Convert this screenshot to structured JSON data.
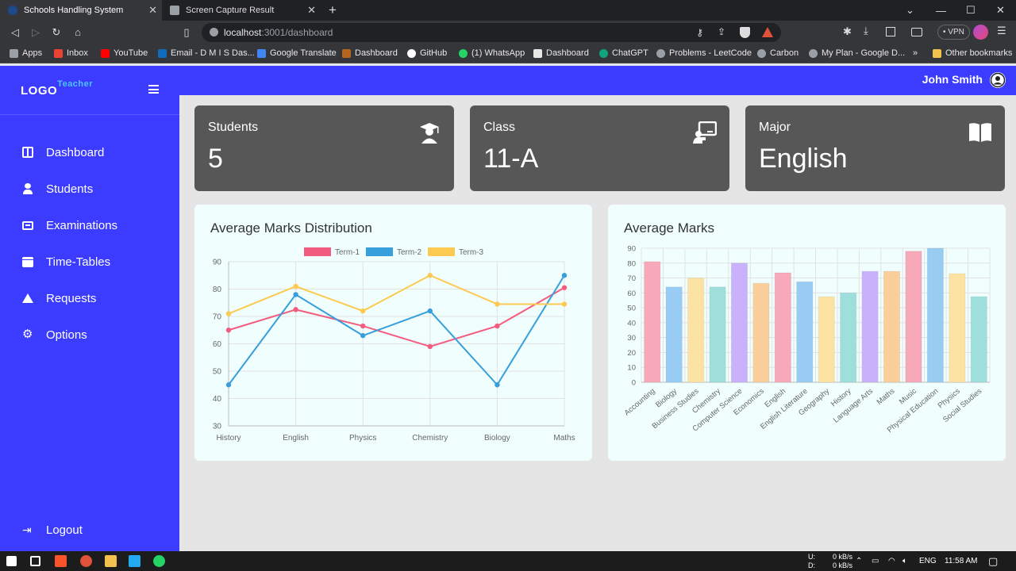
{
  "browser": {
    "tabs": [
      {
        "title": "Schools Handling System",
        "active": true
      },
      {
        "title": "Screen Capture Result",
        "active": false
      }
    ],
    "url_host": "localhost",
    "url_path": ":3001/dashboard",
    "vpn_label": "VPN",
    "bookmarks": [
      "Apps",
      "Inbox",
      "YouTube",
      "Email - D M I S Das...",
      "Google Translate",
      "Dashboard",
      "GitHub",
      "(1) WhatsApp",
      "Dashboard",
      "ChatGPT",
      "Problems - LeetCode",
      "Carbon",
      "My Plan - Google D...",
      "»",
      "Other bookmarks"
    ]
  },
  "sidebar": {
    "logo": "LOGO",
    "logo_sup": "Teacher",
    "items": [
      {
        "label": "Dashboard",
        "icon": "dashboard-icon"
      },
      {
        "label": "Students",
        "icon": "student-icon"
      },
      {
        "label": "Examinations",
        "icon": "exam-icon"
      },
      {
        "label": "Time-Tables",
        "icon": "calendar-icon"
      },
      {
        "label": "Requests",
        "icon": "requests-icon"
      },
      {
        "label": "Options",
        "icon": "gear-icon"
      }
    ],
    "logout": "Logout"
  },
  "header": {
    "user_name": "John Smith"
  },
  "stats": [
    {
      "label": "Students",
      "value": "5",
      "icon": "graduate-icon"
    },
    {
      "label": "Class",
      "value": "11-A",
      "icon": "chalkboard-teacher-icon"
    },
    {
      "label": "Major",
      "value": "English",
      "icon": "book-open-icon"
    }
  ],
  "chart_data": [
    {
      "type": "line",
      "title": "Average Marks Distribution",
      "categories": [
        "History",
        "English",
        "Physics",
        "Chemistry",
        "Biology",
        "Maths"
      ],
      "ylim": [
        30,
        90
      ],
      "yticks": [
        30,
        40,
        50,
        60,
        70,
        80,
        90
      ],
      "grid": true,
      "legend": "top",
      "series": [
        {
          "name": "Term-1",
          "color": "#f25c7f",
          "values": [
            65,
            72.5,
            66.5,
            59,
            66.5,
            80.5
          ]
        },
        {
          "name": "Term-2",
          "color": "#379fdb",
          "values": [
            45,
            78,
            63,
            72,
            45,
            85
          ]
        },
        {
          "name": "Term-3",
          "color": "#fcc951",
          "values": [
            71,
            81,
            72,
            85,
            74.5,
            74.5
          ]
        }
      ]
    },
    {
      "type": "bar",
      "title": "Average Marks",
      "categories": [
        "Accounting",
        "Biology",
        "Business Studies",
        "Chemistry",
        "Computer Science",
        "Economics",
        "English",
        "English Literature",
        "Geography",
        "History",
        "Language Arts",
        "Maths",
        "Music",
        "Physical Education",
        "Physics",
        "Social Studies"
      ],
      "values": [
        81,
        64,
        70,
        64,
        80,
        66.5,
        73.5,
        67.5,
        57.5,
        60,
        74.5,
        74.5,
        88,
        90,
        73,
        57.5
      ],
      "ylim": [
        0,
        90
      ],
      "yticks": [
        0,
        10,
        20,
        30,
        40,
        50,
        60,
        70,
        80,
        90
      ],
      "grid": true,
      "colors": [
        "#f7a8b9",
        "#99ccf3",
        "#fde3a3",
        "#9edfdc",
        "#c9b2fb",
        "#fbcf9b"
      ]
    }
  ],
  "taskbar": {
    "net_up": "0 kB/s",
    "net_down": "0 kB/s",
    "net_u_label": "U:",
    "net_d_label": "D:",
    "lang": "ENG",
    "time": "11:58 AM"
  }
}
